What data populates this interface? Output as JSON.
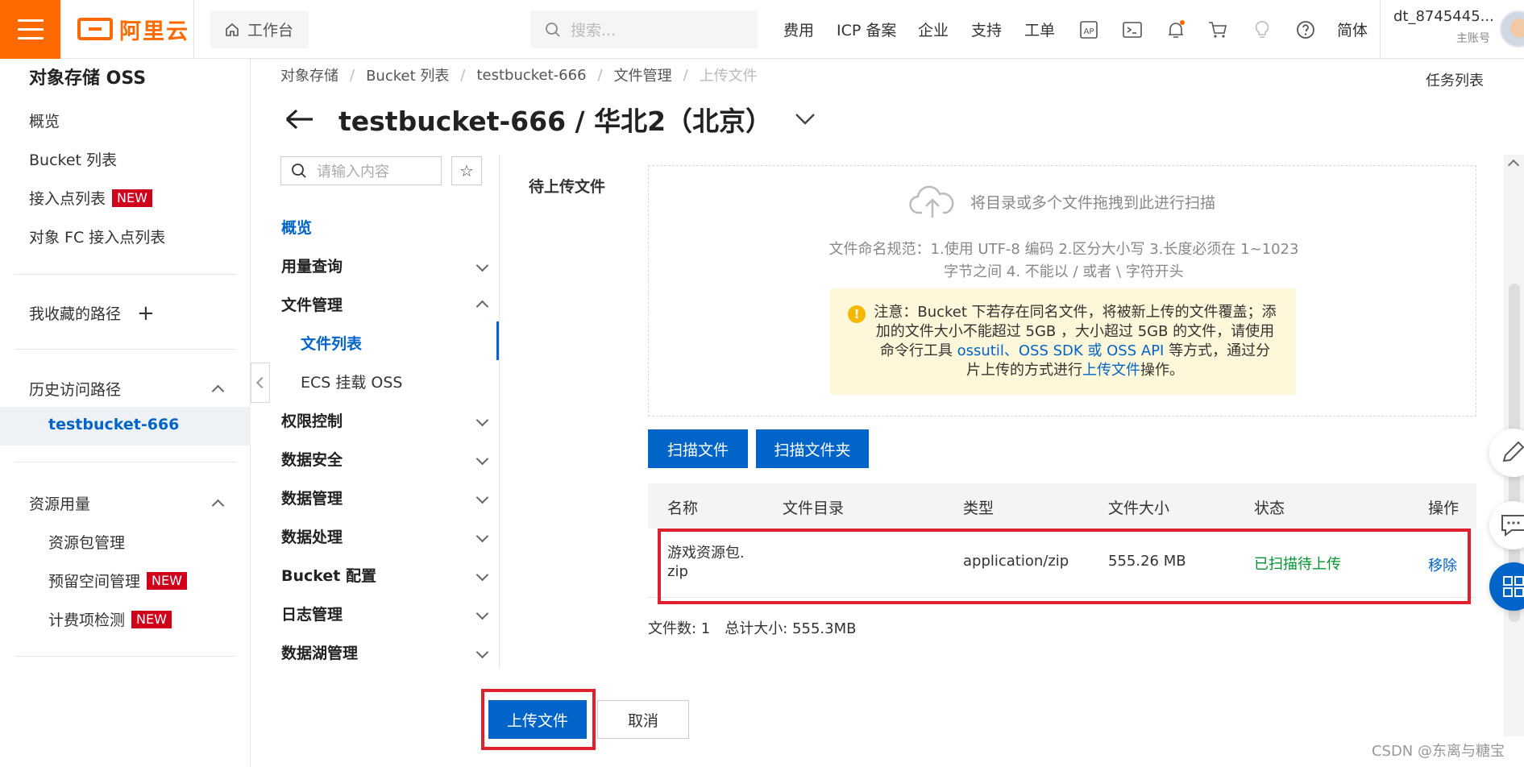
{
  "topbar": {
    "logo_text": "阿里云",
    "workbench": "工作台",
    "search_placeholder": "搜索...",
    "nav": [
      "费用",
      "ICP 备案",
      "企业",
      "支持",
      "工单"
    ],
    "lang": "简体",
    "user_name": "dt_8745445...",
    "user_role": "主账号",
    "icons": [
      "ap-icon",
      "terminal-icon",
      "bell-icon",
      "cart-icon",
      "bulb-icon",
      "help-icon"
    ]
  },
  "sidebar": {
    "title": "对象存储 OSS",
    "items": [
      "概览",
      "Bucket 列表",
      "接入点列表",
      "对象 FC 接入点列表"
    ],
    "new_badge": "NEW",
    "favorites": "我收藏的路径",
    "history": "历史访问路径",
    "history_item": "testbucket-666",
    "resources": "资源用量",
    "resource_items": [
      "资源包管理",
      "预留空间管理",
      "计费项检测"
    ]
  },
  "breadcrumb": [
    "对象存储",
    "Bucket 列表",
    "testbucket-666",
    "文件管理",
    "上传文件"
  ],
  "task_list": "任务列表",
  "page_title": "testbucket-666 / 华北2（北京）",
  "subnav": {
    "search_placeholder": "请输入内容",
    "overview": "概览",
    "groups": [
      "用量查询",
      "文件管理",
      "权限控制",
      "数据安全",
      "数据管理",
      "数据处理",
      "Bucket 配置",
      "日志管理",
      "数据湖管理"
    ],
    "file_children": [
      "文件列表",
      "ECS 挂载 OSS"
    ]
  },
  "upload": {
    "pending_label": "待上传文件",
    "drop_hint": "将目录或多个文件拖拽到此进行扫描",
    "naming_rule": "文件命名规范：1.使用 UTF-8 编码 2.区分大小写 3.长度必须在 1~1023 字节之间 4. 不能以 / 或者 \\ 字符开头",
    "notice_1": "注意：Bucket 下若存在同名文件，将被新上传的文件覆盖；添加的文件大小不能超过 5GB ，大小超过 5GB 的文件，请使用命令行工具 ",
    "notice_link_1": "ossutil、OSS SDK 或 OSS API",
    "notice_2": " 等方式，通过分片上传的方式进行",
    "notice_link_2": "上传文件",
    "notice_3": "操作。",
    "scan_file": "扫描文件",
    "scan_folder": "扫描文件夹"
  },
  "table": {
    "headers": [
      "名称",
      "文件目录",
      "类型",
      "文件大小",
      "状态",
      "操作"
    ],
    "row": {
      "name_line1": "游戏资源包.",
      "name_line2": "zip",
      "dir": "",
      "type": "application/zip",
      "size": "555.26 MB",
      "status": "已扫描待上传",
      "action": "移除"
    }
  },
  "summary": {
    "count": "文件数: 1",
    "total": "总计大小: 555.3MB"
  },
  "footer": {
    "upload": "上传文件",
    "cancel": "取消"
  },
  "watermark": "CSDN @东离与糖宝"
}
